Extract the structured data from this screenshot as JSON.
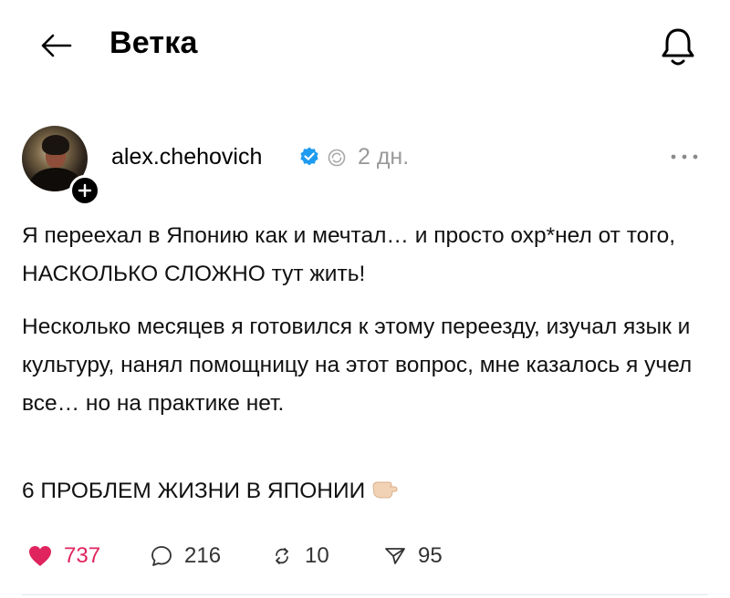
{
  "header": {
    "title": "Ветка",
    "back_icon": "arrow-left-icon",
    "bell_icon": "bell-icon"
  },
  "post": {
    "username": "alex.chehovich",
    "time": "2 дн.",
    "verified_color": "#1d9bf0",
    "paragraphs": [
      "Я переехал в Японию как и мечтал… и просто охр*нел от того, НАСКОЛЬКО СЛОЖНО тут жить!",
      "Несколько месяцев я готовился к этому переезду, изучал язык и культуру, нанял помощницу на этот вопрос, мне казалось я учел все… но на практике нет.",
      "6 ПРОБЛЕМ ЖИЗНИ В ЯПОНИИ"
    ],
    "actions": {
      "likes": "737",
      "replies": "216",
      "reposts": "10",
      "shares": "95"
    },
    "like_color": "#e0245e"
  }
}
